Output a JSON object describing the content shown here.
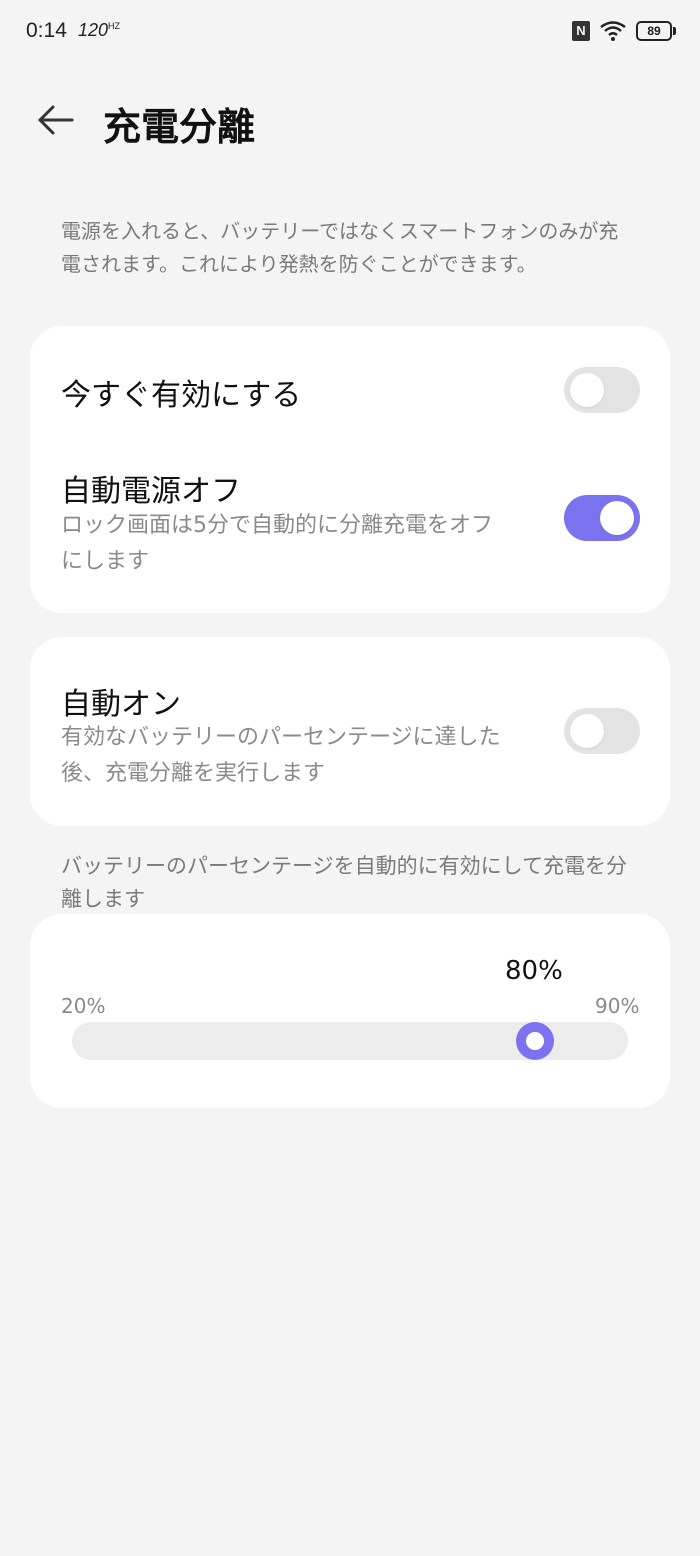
{
  "status_bar": {
    "time": "0:14",
    "refresh_rate": "120",
    "refresh_unit": "HZ",
    "nfc_label": "N",
    "battery_level": "89",
    "icons": [
      "nfc-icon",
      "wifi-icon",
      "battery-icon"
    ]
  },
  "header": {
    "title": "充電分離",
    "back_icon": "arrow-left-icon"
  },
  "description": "電源を入れると、バッテリーではなくスマートフォンのみが充電されます。これにより発熱を防ぐことができます。",
  "card1": {
    "enable_now": {
      "title": "今すぐ有効にする",
      "enabled": false
    },
    "auto_power_off": {
      "title": "自動電源オフ",
      "subtitle": "ロック画面は5分で自動的に分離充電をオフにします",
      "enabled": true
    }
  },
  "card2": {
    "auto_on": {
      "title": "自動オン",
      "subtitle": "有効なバッテリーのパーセンテージに達した後、充電分離を実行します",
      "enabled": false
    }
  },
  "section_note": "バッテリーのパーセンテージを自動的に有効にして充電を分離します",
  "slider": {
    "value_label": "80%",
    "min_label": "20%",
    "max_label": "90%",
    "value": 80,
    "min": 20,
    "max": 90
  },
  "colors": {
    "accent": "#7a72ef",
    "background": "#f4f4f4",
    "card": "#ffffff",
    "toggle_off": "#e3e3e3"
  }
}
